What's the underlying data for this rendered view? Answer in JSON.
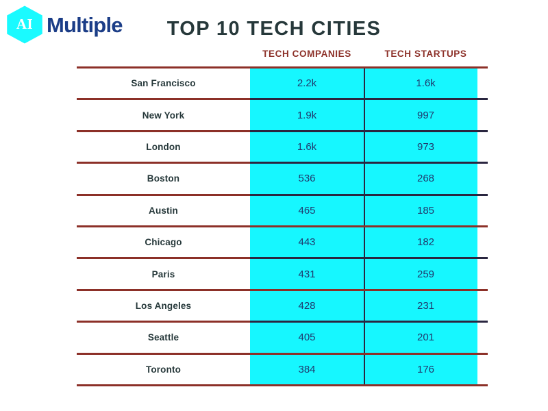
{
  "brand": {
    "mark_text": "AI",
    "word": "Multiple",
    "hex_color": "#1afaff",
    "word_color": "#1b3d87"
  },
  "title": "TOP 10 TECH CITIES",
  "title_color": "#26383a",
  "palette": {
    "cyan": "#16f7ff",
    "rule_red": "#8c3028",
    "rule_dark": "#2a2640",
    "value_text": "#203a6e",
    "city_text": "#26383a",
    "header_text": "#8c3028"
  },
  "chart_data": {
    "type": "table",
    "title": "TOP 10 TECH CITIES",
    "columns": [
      "",
      "TECH COMPANIES",
      "TECH STARTUPS"
    ],
    "categories": [
      "San Francisco",
      "New York",
      "London",
      "Boston",
      "Austin",
      "Chicago",
      "Paris",
      "Los Angeles",
      "Seattle",
      "Toronto"
    ],
    "series": [
      {
        "name": "TECH COMPANIES",
        "values": [
          "2.2k",
          "1.9k",
          "1.6k",
          "536",
          "465",
          "443",
          "431",
          "428",
          "405",
          "384"
        ],
        "numeric": [
          2200,
          1900,
          1600,
          536,
          465,
          443,
          431,
          428,
          405,
          384
        ]
      },
      {
        "name": "TECH STARTUPS",
        "values": [
          "1.6k",
          "997",
          "973",
          "268",
          "185",
          "182",
          "259",
          "231",
          "201",
          "176"
        ],
        "numeric": [
          1600,
          997,
          973,
          268,
          185,
          182,
          259,
          231,
          201,
          176
        ]
      }
    ],
    "rows": [
      {
        "city": "San Francisco",
        "companies": "2.2k",
        "startups": "1.6k"
      },
      {
        "city": "New York",
        "companies": "1.9k",
        "startups": "997"
      },
      {
        "city": "London",
        "companies": "1.6k",
        "startups": "973"
      },
      {
        "city": "Boston",
        "companies": "536",
        "startups": "268"
      },
      {
        "city": "Austin",
        "companies": "465",
        "startups": "185"
      },
      {
        "city": "Chicago",
        "companies": "443",
        "startups": "182"
      },
      {
        "city": "Paris",
        "companies": "431",
        "startups": "259"
      },
      {
        "city": "Los Angeles",
        "companies": "428",
        "startups": "231"
      },
      {
        "city": "Seattle",
        "companies": "405",
        "startups": "201"
      },
      {
        "city": "Toronto",
        "companies": "384",
        "startups": "176"
      }
    ],
    "legend_position": "top",
    "grid": true
  }
}
